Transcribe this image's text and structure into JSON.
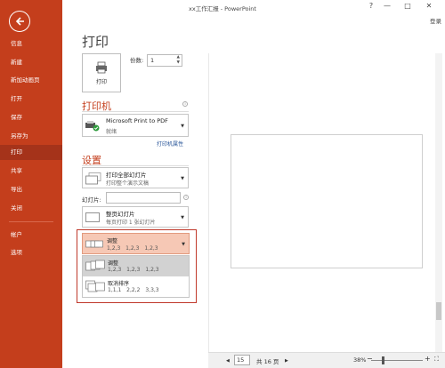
{
  "window": {
    "title": "xx工作汇报 - PowerPoint",
    "help": "?",
    "minimize": "—",
    "restore": "□",
    "close": "✕",
    "login": "登录"
  },
  "sidebar": {
    "items": [
      {
        "label": "信息"
      },
      {
        "label": "新建"
      },
      {
        "label": "新加动画页"
      },
      {
        "label": "打开"
      },
      {
        "label": "保存"
      },
      {
        "label": "另存为"
      },
      {
        "label": "打印"
      },
      {
        "label": "共享"
      },
      {
        "label": "导出"
      },
      {
        "label": "关闭"
      },
      {
        "label": "帐户"
      },
      {
        "label": "选项"
      }
    ],
    "active": "打印"
  },
  "print": {
    "page_title": "打印",
    "print_button": "打印",
    "copies_label": "份数:",
    "copies_value": "1"
  },
  "printer": {
    "section_title": "打印机",
    "name": "Microsoft Print to PDF",
    "status": "就绪",
    "properties_link": "打印机属性"
  },
  "settings": {
    "section_title": "设置",
    "range_main": "打印全部幻灯片",
    "range_sub": "打印整个演示文稿",
    "slides_label": "幻灯片:",
    "slides_value": "",
    "layout_main": "整页幻灯片",
    "layout_sub": "每页打印 1 张幻灯片",
    "collate_main": "调整",
    "collate_sub": "1,2,3    1,2,3    1,2,3"
  },
  "collate_menu": {
    "options": [
      {
        "title": "调整",
        "sub": "1,2,3    1,2,3    1,2,3"
      },
      {
        "title": "取消排序",
        "sub": "1,1,1    2,2,2    3,3,3"
      }
    ]
  },
  "preview": {
    "page_current": "15",
    "page_total_text": "共 16 页",
    "prev": "◀",
    "next": "▶",
    "zoom": "38%",
    "zoom_level_percent": 38
  },
  "colors": {
    "accent": "#c43e1c",
    "highlight": "#f6c8b5",
    "selected_option": "#d2d2d2",
    "red_frame": "#c0392b",
    "link": "#2b579a"
  }
}
